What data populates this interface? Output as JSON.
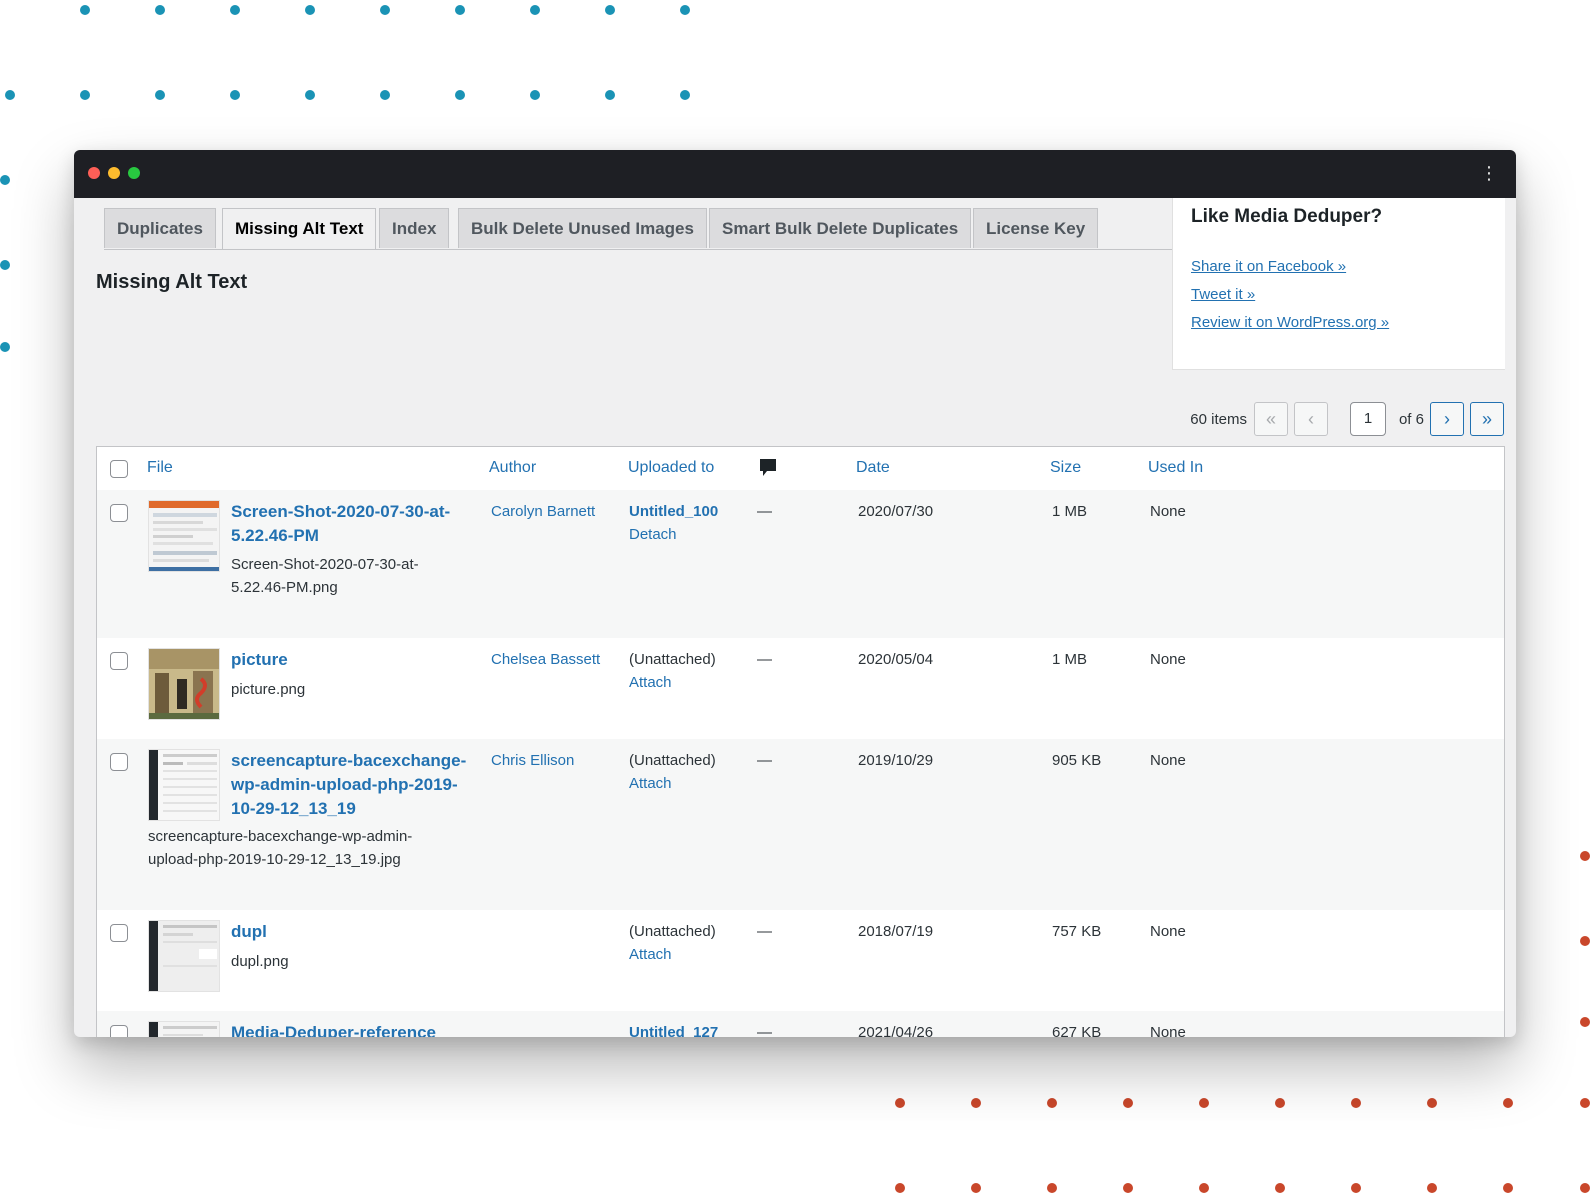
{
  "window": {
    "tabs": [
      "Duplicates",
      "Missing Alt Text",
      "Index",
      "Bulk Delete Unused Images",
      "Smart Bulk Delete Duplicates",
      "License Key"
    ],
    "active_tab": 1,
    "page_title": "Missing Alt Text"
  },
  "promo": {
    "title": "Like Media Deduper?",
    "links": [
      "Share it on Facebook »",
      "Tweet it »",
      "Review it on WordPress.org »"
    ]
  },
  "pagination": {
    "count": "60 items",
    "first": "«",
    "prev": "‹",
    "current_page": "1",
    "of": "of 6",
    "next": "›",
    "last": "»"
  },
  "table": {
    "headers": {
      "file": "File",
      "author": "Author",
      "uploaded_to": "Uploaded to",
      "comments_icon": "comment-bubble-icon",
      "date": "Date",
      "size": "Size",
      "used_in": "Used In"
    },
    "rows": [
      {
        "title": "Screen-Shot-2020-07-30-at-5.22.46-PM",
        "filename": "Screen-Shot-2020-07-30-at-5.22.46-PM.png",
        "author": "Carolyn Barnett",
        "uploaded_to": "Untitled_100",
        "action": "Detach",
        "comments": "—",
        "date": "2020/07/30",
        "size": "1 MB",
        "used_in": "None"
      },
      {
        "title": "picture",
        "filename": "picture.png",
        "author": "Chelsea Bassett",
        "uploaded_to": "(Unattached)",
        "action": "Attach",
        "comments": "—",
        "date": "2020/05/04",
        "size": "1 MB",
        "used_in": "None"
      },
      {
        "title": "screencapture-bacexchange-wp-admin-upload-php-2019-10-29-12_13_19",
        "filename": "screencapture-bacexchange-wp-admin-upload-php-2019-10-29-12_13_19.jpg",
        "author": "Chris Ellison",
        "uploaded_to": "(Unattached)",
        "action": "Attach",
        "comments": "—",
        "date": "2019/10/29",
        "size": "905 KB",
        "used_in": "None"
      },
      {
        "title": "dupl",
        "filename": "dupl.png",
        "author": "",
        "uploaded_to": "(Unattached)",
        "action": "Attach",
        "comments": "—",
        "date": "2018/07/19",
        "size": "757 KB",
        "used_in": "None"
      },
      {
        "title": "Media-Deduper-reference",
        "filename": "",
        "author": "",
        "uploaded_to": "Untitled_127",
        "action": "",
        "comments": "—",
        "date": "2021/04/26",
        "size": "627 KB",
        "used_in": "None"
      }
    ]
  },
  "colors": {
    "link": "#2271b1",
    "titlebar": "#1e1f24",
    "dot_blue": "#1a93b5",
    "dot_red": "#c9472b"
  }
}
